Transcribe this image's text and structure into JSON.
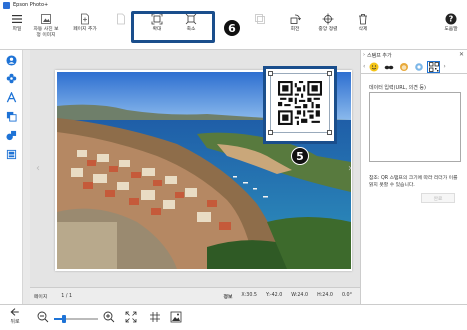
{
  "window": {
    "title": "Epson Photo+"
  },
  "toolbar": {
    "file": "파일",
    "auto_correct": "자동 사진 보정 이미지",
    "add_page": "페이지 추가",
    "enlarge": "확대",
    "reduce": "축소",
    "rotate": "회전",
    "center": "중앙 정렬",
    "delete": "삭제",
    "help": "도움말"
  },
  "badges": {
    "toolbar": "6",
    "stamp": "5"
  },
  "status": {
    "page_label": "페이지",
    "page_value": "1 / 1",
    "info_label": "정보",
    "x": "X:30.5",
    "y": "Y:-42.0",
    "w": "W:24.0",
    "h": "H:24.0",
    "angle": "0.0°"
  },
  "bottom": {
    "back": "뒤로"
  },
  "panel": {
    "title": "스탬프 추가",
    "label": "데이터 입력(URL, 의견 등)",
    "note": "참조: QR 스탬프의 크기에 따라 리더가 이를 읽지 못할 수 있습니다.",
    "button": "완료"
  },
  "colors": {
    "accent": "#1e73d6",
    "highlight": "#1a4e8c"
  }
}
